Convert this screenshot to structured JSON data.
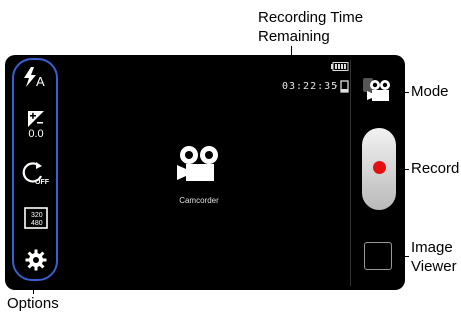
{
  "callouts": {
    "recording_time": "Recording Time\nRemaining",
    "mode": "Mode",
    "record": "Record",
    "image_viewer": "Image\nViewer",
    "options": "Options"
  },
  "status": {
    "time_remaining": "03:22:35"
  },
  "options": {
    "exposure_value": "0.0",
    "timer_state": "OFF",
    "resolution_top": "320",
    "resolution_bottom": "480",
    "flash_mode": "A"
  },
  "viewfinder": {
    "mode_label": "Camcorder"
  },
  "colors": {
    "screen_bg": "#000000",
    "options_ring": "#3a5fd0",
    "record_dot": "#e41010"
  },
  "icons": [
    "flash-auto-icon",
    "exposure-icon",
    "timer-off-icon",
    "resolution-icon",
    "gear-icon",
    "battery-icon",
    "storage-icon",
    "camcorder-icon",
    "mode-camcorder-icon",
    "record-dot-icon"
  ]
}
